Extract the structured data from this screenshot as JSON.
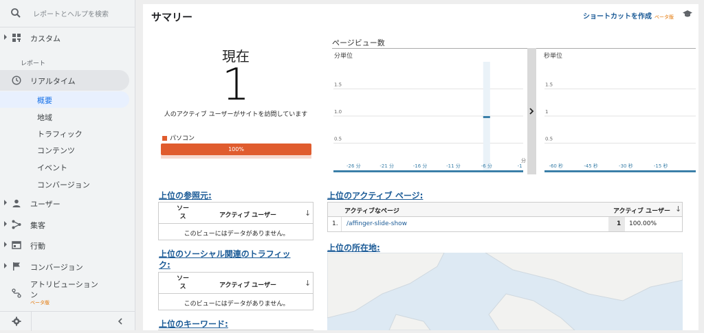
{
  "search": {
    "placeholder": "レポートとヘルプを検索"
  },
  "sidebar": {
    "custom": "カスタム",
    "section_label": "レポート",
    "realtime": "リアルタイム",
    "realtime_items": [
      "概要",
      "地域",
      "トラフィック",
      "コンテンツ",
      "イベント",
      "コンバージョン"
    ],
    "items": [
      {
        "label": "ユーザー",
        "icon": "person-icon"
      },
      {
        "label": "集客",
        "icon": "acquisition-icon"
      },
      {
        "label": "行動",
        "icon": "behavior-icon"
      },
      {
        "label": "コンバージョン",
        "icon": "flag-icon"
      }
    ],
    "attribution": "アトリビューション",
    "attribution_line2": "ン",
    "beta": "ベータ版"
  },
  "header": {
    "title": "サマリー",
    "shortcut": "ショートカットを作成",
    "beta": "ベータ版"
  },
  "current": {
    "label": "現在",
    "value": "1",
    "description": "人のアクティブ ユーザーがサイトを訪問しています",
    "device_label": "パソコン",
    "device_percent": "100%",
    "device_fraction": 1.0,
    "accent": "#e05c2e"
  },
  "chart_data": [
    {
      "type": "bar",
      "title": "ページビュー数",
      "subtitle": "分単位",
      "x": [
        "-26 分",
        "-21 分",
        "-16 分",
        "-11 分",
        "-6 分",
        "-1"
      ],
      "x_values": [
        -26,
        -21,
        -16,
        -11,
        -6,
        -1
      ],
      "bars": [
        {
          "x": -6,
          "y": 1
        }
      ],
      "ylim": [
        0,
        2
      ],
      "yticks": [
        "1.5",
        "1.0",
        "0.5"
      ],
      "ytick_values": [
        1.5,
        1.0,
        0.5
      ],
      "xunit": "分",
      "color": "#3a7fa8"
    },
    {
      "type": "bar",
      "subtitle": "秒単位",
      "x": [
        "-60 秒",
        "-45 秒",
        "-30 秒",
        "-15 秒"
      ],
      "x_values": [
        -60,
        -45,
        -30,
        -15
      ],
      "bars": [],
      "ylim": [
        0,
        2
      ],
      "yticks": [
        "1.5",
        "1",
        "0.5"
      ],
      "ytick_values": [
        1.5,
        1,
        0.5
      ]
    }
  ],
  "referrals": {
    "title": "上位の参照元:",
    "col_source": "ソース",
    "col_users": "アクティブ ユーザー",
    "empty": "このビューにはデータがありません。"
  },
  "social": {
    "title_line1": "上位のソーシャル関連のトラフィッ",
    "title_line2": "ク:",
    "col_source": "ソース",
    "col_users": "アクティブ ユーザー",
    "empty": "このビューにはデータがありません。"
  },
  "keywords": {
    "title": "上位のキーワード:"
  },
  "active_pages": {
    "title": "上位のアクティブ ページ:",
    "col_page": "アクティブなページ",
    "col_users": "アクティブ ユーザー",
    "rows": [
      {
        "index": "1.",
        "page": "/affinger-slide-show",
        "count": "1",
        "percent": "100.00%"
      }
    ]
  },
  "locations": {
    "title": "上位の所在地:"
  }
}
